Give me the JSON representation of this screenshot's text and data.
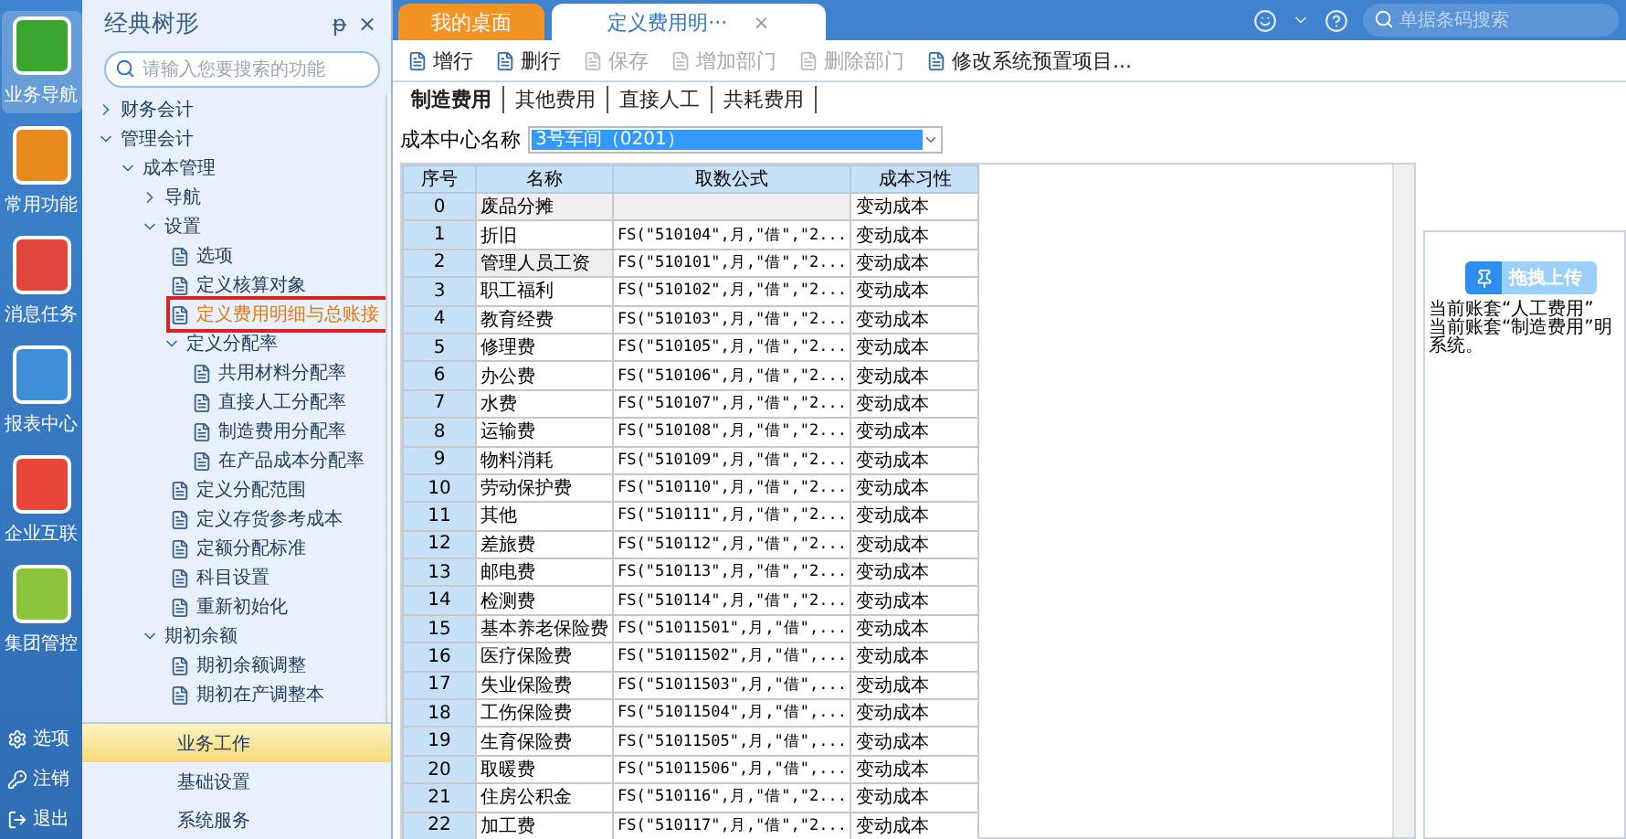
{
  "rail": {
    "items": [
      {
        "label": "业务导航",
        "selected": true,
        "color": "#3aa52f"
      },
      {
        "label": "常用功能",
        "selected": false,
        "color": "#e8891d"
      },
      {
        "label": "消息任务",
        "selected": false,
        "color": "#e0463a"
      },
      {
        "label": "报表中心",
        "selected": false,
        "color": "#3f8fd8"
      },
      {
        "label": "企业互联",
        "selected": false,
        "color": "#e8463a"
      },
      {
        "label": "集团管控",
        "selected": false,
        "color": "#8cc43c"
      }
    ],
    "bottom": [
      {
        "label": "选项",
        "kind": "gear"
      },
      {
        "label": "注销",
        "kind": "key"
      },
      {
        "label": "退出",
        "kind": "exit"
      }
    ]
  },
  "tree_panel": {
    "title": "经典树形",
    "pin": "ᵽ",
    "close": "×",
    "search": {
      "placeholder": "请输入您要搜索的功能"
    },
    "items": [
      {
        "label": "财务会计",
        "kind": "folder",
        "expanded": false
      },
      {
        "label": "管理会计",
        "kind": "folder",
        "expanded": true,
        "children": [
          {
            "label": "成本管理",
            "kind": "folder",
            "expanded": true,
            "children": [
              {
                "label": "导航",
                "kind": "folder",
                "expanded": false
              },
              {
                "label": "设置",
                "kind": "folder",
                "expanded": true,
                "children": [
                  {
                    "label": "选项",
                    "selected": false
                  },
                  {
                    "label": "定义核算对象",
                    "selected": false
                  },
                  {
                    "label": "定义费用明细与总账接",
                    "selected": true
                  },
                  {
                    "label": "定义分配率",
                    "kind": "folder",
                    "expanded": true,
                    "children": [
                      {
                        "label": "共用材料分配率",
                        "selected": false
                      },
                      {
                        "label": "直接人工分配率",
                        "selected": false
                      },
                      {
                        "label": "制造费用分配率",
                        "selected": false
                      },
                      {
                        "label": "在产品成本分配率",
                        "selected": false
                      }
                    ]
                  },
                  {
                    "label": "定义分配范围",
                    "selected": false
                  },
                  {
                    "label": "定义存货参考成本",
                    "selected": false
                  },
                  {
                    "label": "定额分配标准",
                    "selected": false
                  },
                  {
                    "label": "科目设置",
                    "selected": false
                  },
                  {
                    "label": "重新初始化",
                    "selected": false
                  }
                ]
              },
              {
                "label": "期初余额",
                "kind": "folder",
                "expanded": true,
                "children": [
                  {
                    "label": "期初余额调整",
                    "selected": false
                  },
                  {
                    "label": "期初在产调整本",
                    "selected": false
                  }
                ]
              }
            ]
          }
        ]
      }
    ],
    "nav": [
      {
        "label": "业务工作",
        "selected": true
      },
      {
        "label": "基础设置",
        "selected": false
      },
      {
        "label": "系统服务",
        "selected": false
      }
    ]
  },
  "top_bar": {
    "tabs": [
      {
        "label": "我的桌面",
        "selected": false,
        "closable": false
      },
      {
        "label": "定义费用明···",
        "selected": true,
        "closable": true
      }
    ],
    "close": "×",
    "search": {
      "placeholder": "单据条码搜索"
    }
  },
  "toolbar": [
    {
      "label": "增行",
      "disabled": false
    },
    {
      "label": "删行",
      "disabled": false
    },
    {
      "label": "保存",
      "disabled": true
    },
    {
      "label": "增加部门",
      "disabled": true
    },
    {
      "label": "删除部门",
      "disabled": true
    },
    {
      "label": "修改系统预置项目...",
      "disabled": false
    }
  ],
  "sub_tabs": [
    {
      "label": "制造费用",
      "selected": true
    },
    {
      "label": "其他费用",
      "selected": false
    },
    {
      "label": "直接人工",
      "selected": false
    },
    {
      "label": "共耗费用",
      "selected": false
    }
  ],
  "cost_center": {
    "label": "成本中心名称",
    "value": "3号车间（0201）"
  },
  "table": {
    "columns": [
      "序号",
      "名称",
      "取数公式",
      "成本习性"
    ],
    "rows": [
      [
        "0",
        "废品分摊",
        "",
        "变动成本"
      ],
      [
        "1",
        "折旧",
        "FS(\"510104\",月,\"借\",\"2...",
        "变动成本"
      ],
      [
        "2",
        "管理人员工资",
        "FS(\"510101\",月,\"借\",\"2...",
        "变动成本"
      ],
      [
        "3",
        "职工福利",
        "FS(\"510102\",月,\"借\",\"2...",
        "变动成本"
      ],
      [
        "4",
        "教育经费",
        "FS(\"510103\",月,\"借\",\"2...",
        "变动成本"
      ],
      [
        "5",
        "修理费",
        "FS(\"510105\",月,\"借\",\"2...",
        "变动成本"
      ],
      [
        "6",
        "办公费",
        "FS(\"510106\",月,\"借\",\"2...",
        "变动成本"
      ],
      [
        "7",
        "水费",
        "FS(\"510107\",月,\"借\",\"2...",
        "变动成本"
      ],
      [
        "8",
        "运输费",
        "FS(\"510108\",月,\"借\",\"2...",
        "变动成本"
      ],
      [
        "9",
        "物料消耗",
        "FS(\"510109\",月,\"借\",\"2...",
        "变动成本"
      ],
      [
        "10",
        "劳动保护费",
        "FS(\"510110\",月,\"借\",\"2...",
        "变动成本"
      ],
      [
        "11",
        "其他",
        "FS(\"510111\",月,\"借\",\"2...",
        "变动成本"
      ],
      [
        "12",
        "差旅费",
        "FS(\"510112\",月,\"借\",\"2...",
        "变动成本"
      ],
      [
        "13",
        "邮电费",
        "FS(\"510113\",月,\"借\",\"2...",
        "变动成本"
      ],
      [
        "14",
        "检测费",
        "FS(\"510114\",月,\"借\",\"2...",
        "变动成本"
      ],
      [
        "15",
        "基本养老保险费",
        "FS(\"51011501\",月,\"借\",...",
        "变动成本"
      ],
      [
        "16",
        "医疗保险费",
        "FS(\"51011502\",月,\"借\",...",
        "变动成本"
      ],
      [
        "17",
        "失业保险费",
        "FS(\"51011503\",月,\"借\",...",
        "变动成本"
      ],
      [
        "18",
        "工伤保险费",
        "FS(\"51011504\",月,\"借\",...",
        "变动成本"
      ],
      [
        "19",
        "生育保险费",
        "FS(\"51011505\",月,\"借\",...",
        "变动成本"
      ],
      [
        "20",
        "取暖费",
        "FS(\"51011506\",月,\"借\",...",
        "变动成本"
      ],
      [
        "21",
        "住房公积金",
        "FS(\"510116\",月,\"借\",\"2...",
        "变动成本"
      ],
      [
        "22",
        "加工费",
        "FS(\"510117\",月,\"借\",\"2...",
        "变动成本"
      ]
    ]
  },
  "info_panel": {
    "lines": [
      "当前账套“人工费用”",
      "当前账套“制造费用”明",
      "系统。"
    ],
    "upload_badge": "拖拽上传"
  }
}
